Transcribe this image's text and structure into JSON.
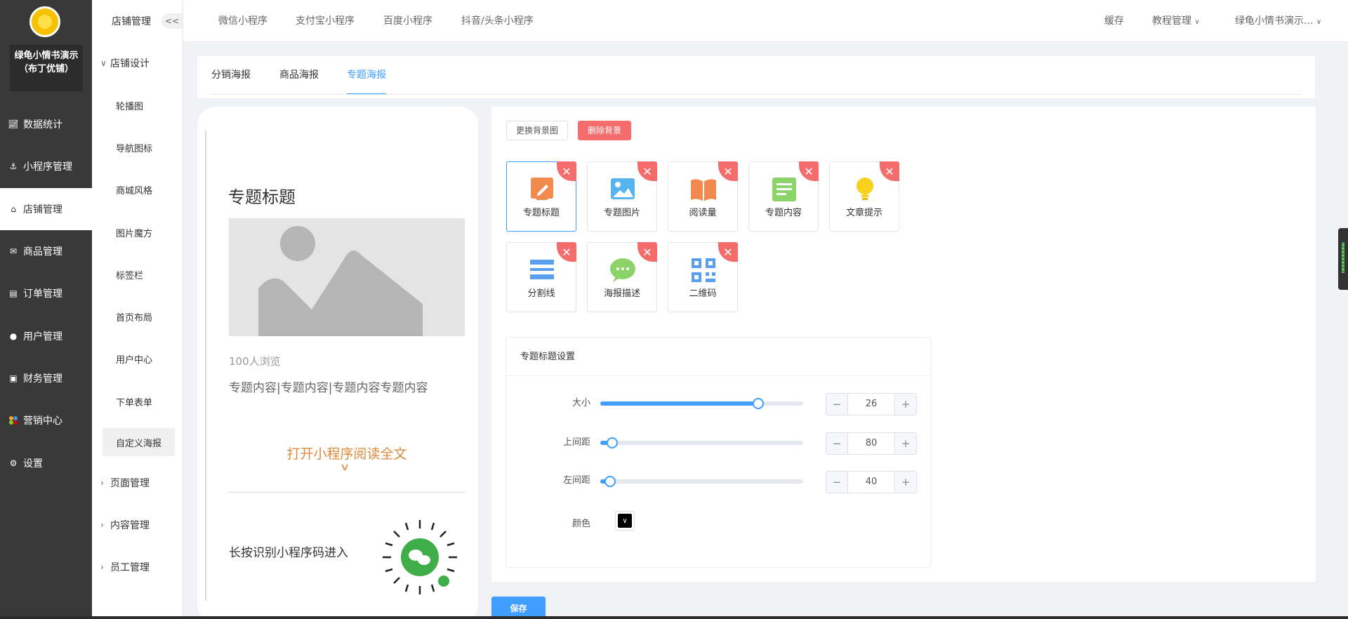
{
  "sidebar": {
    "store_name": "绿龟小情书演示（布丁优铺）",
    "items": [
      {
        "label": "数据统计",
        "icon": "chart-icon"
      },
      {
        "label": "小程序管理",
        "icon": "link-icon"
      },
      {
        "label": "店铺管理",
        "icon": "store-icon"
      },
      {
        "label": "商品管理",
        "icon": "envelope-icon"
      },
      {
        "label": "订单管理",
        "icon": "order-icon"
      },
      {
        "label": "用户管理",
        "icon": "user-icon"
      },
      {
        "label": "财务管理",
        "icon": "finance-icon"
      },
      {
        "label": "营销中心",
        "icon": "marketing-icon"
      },
      {
        "label": "设置",
        "icon": "gear-icon"
      }
    ]
  },
  "subnav": {
    "title": "店铺管理",
    "collapse": "<<",
    "group1": "店铺设计",
    "items": [
      "轮播图",
      "导航图标",
      "商城风格",
      "图片魔方",
      "标签栏",
      "首页布局",
      "用户中心",
      "下单表单",
      "自定义海报"
    ],
    "groups": [
      "页面管理",
      "内容管理",
      "员工管理"
    ]
  },
  "topbar": {
    "tabs": [
      "微信小程序",
      "支付宝小程序",
      "百度小程序",
      "抖音/头条小程序"
    ],
    "cache": "缓存",
    "tutorial": "教程管理",
    "account": "绿龟小情书演示..."
  },
  "content_tabs": [
    "分销海报",
    "商品海报",
    "专题海报"
  ],
  "poster": {
    "title": "专题标题",
    "reads": "100人浏览",
    "text": "专题内容|专题内容|专题内容专题内容",
    "cta": "打开小程序阅读全文",
    "scan": "长按识别小程序码进入"
  },
  "editor": {
    "change_bg": "更换背景图",
    "delete_bg": "删除背景",
    "components": [
      {
        "label": "专题标题",
        "icon": "pen-icon",
        "color": "#f28a50"
      },
      {
        "label": "专题图片",
        "icon": "image-icon",
        "color": "#56b4f0"
      },
      {
        "label": "阅读量",
        "icon": "book-icon",
        "color": "#f28a50"
      },
      {
        "label": "专题内容",
        "icon": "document-icon",
        "color": "#8cd46a"
      },
      {
        "label": "文章提示",
        "icon": "bulb-icon",
        "color": "#f8d21e"
      },
      {
        "label": "分割线",
        "icon": "divider-icon",
        "color": "#5a9ef0"
      },
      {
        "label": "海报描述",
        "icon": "chat-icon",
        "color": "#8cd46a"
      },
      {
        "label": "二维码",
        "icon": "qrcode-icon",
        "color": "#5a9ef0"
      }
    ],
    "settings_title": "专题标题设置",
    "rows": [
      {
        "label": "大小",
        "value": "26",
        "slider": 0.78
      },
      {
        "label": "上间距",
        "value": "80",
        "slider": 0.06
      },
      {
        "label": "左间距",
        "value": "40",
        "slider": 0.05
      }
    ],
    "color_label": "颜色",
    "color_value": "#000000",
    "save": "保存"
  },
  "colors": {
    "accent": "#409eff",
    "danger": "#f56c6c",
    "cta": "#e08a3a"
  }
}
